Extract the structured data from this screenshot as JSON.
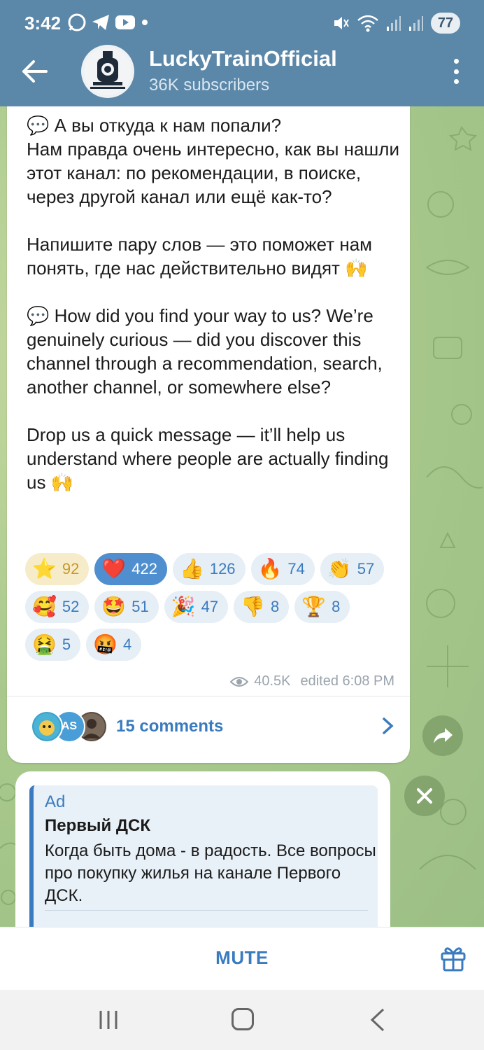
{
  "status_bar": {
    "time": "3:42",
    "battery": "77",
    "left_icons": [
      "whatsapp-icon",
      "telegram-icon",
      "youtube-icon",
      "dot-icon"
    ],
    "right_icons": [
      "mute-icon",
      "wifi-icon",
      "signal-icon",
      "signal-icon"
    ]
  },
  "header": {
    "title": "LuckyTrainOfficial",
    "subtitle": "36K subscribers"
  },
  "post": {
    "text_ru_1": "💬 А вы откуда к нам попали?\nНам правда очень интересно, как вы нашли этот канал: по рекомендации, в поиске, через другой канал или ещё как-то?",
    "text_ru_2": "Напишите пару слов — это поможет нам понять, где нас действительно видят 🙌",
    "text_en_1": "💬 How did you find your way to us? We’re genuinely curious — did you discover this channel through a recommendation, search, another channel, or somewhere else?",
    "text_en_2": "Drop us a quick message — it’ll help us understand where people are actually finding us 🙌",
    "reactions": [
      {
        "emoji": "⭐",
        "count": "92"
      },
      {
        "emoji": "❤️",
        "count": "422"
      },
      {
        "emoji": "👍",
        "count": "126"
      },
      {
        "emoji": "🔥",
        "count": "74"
      },
      {
        "emoji": "👏",
        "count": "57"
      },
      {
        "emoji": "🥰",
        "count": "52"
      },
      {
        "emoji": "🤩",
        "count": "51"
      },
      {
        "emoji": "🎉",
        "count": "47"
      },
      {
        "emoji": "👎",
        "count": "8"
      },
      {
        "emoji": "🏆",
        "count": "8"
      },
      {
        "emoji": "🤮",
        "count": "5"
      },
      {
        "emoji": "🤬",
        "count": "4"
      }
    ],
    "views": "40.5K",
    "edited": "edited 6:08 PM",
    "comments_label": "15 comments",
    "commenter_initials": "AS"
  },
  "ad": {
    "tag": "Ad",
    "title": "Первый ДСК",
    "text": "Когда быть дома - в радость. Все вопросы про покупку жилья на канале Первого ДСК."
  },
  "bottom": {
    "mute_label": "MUTE"
  },
  "colors": {
    "header": "#5b87a8",
    "accent": "#3a7bbf",
    "chat_bg": "#a9c98c"
  }
}
